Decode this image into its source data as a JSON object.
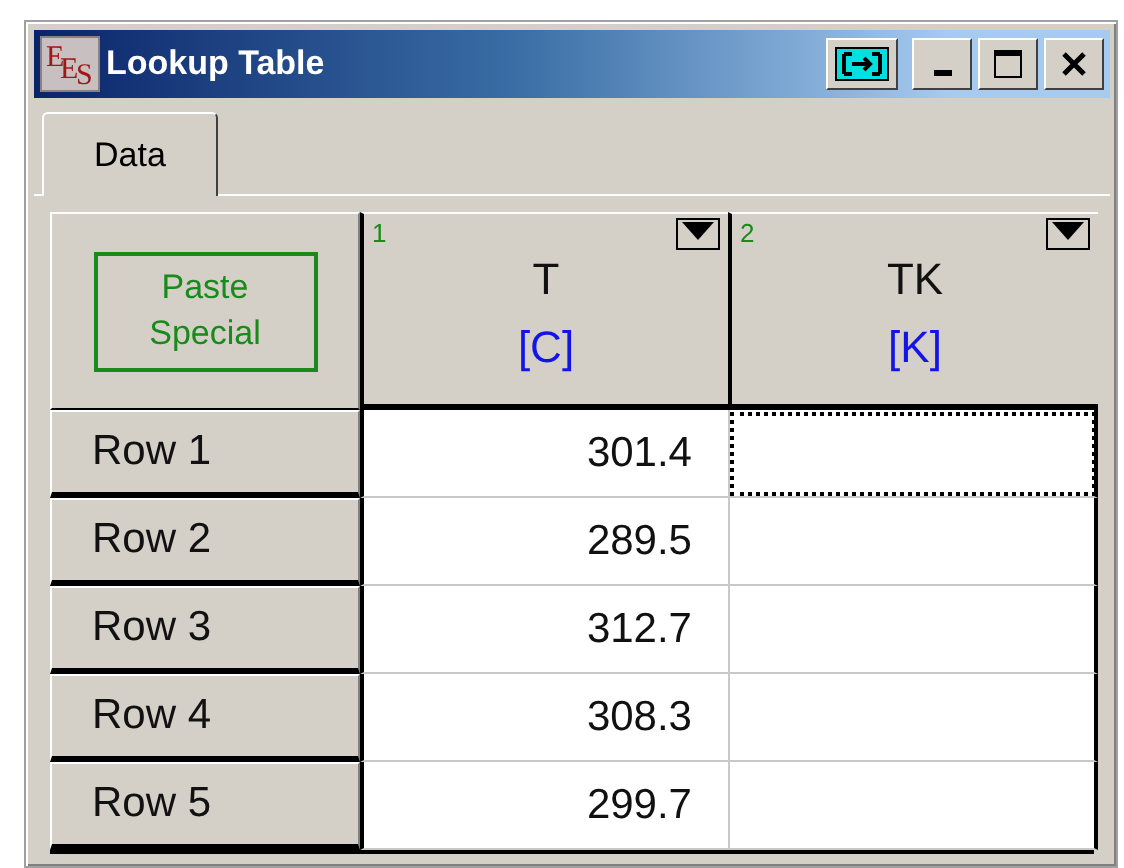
{
  "window": {
    "app_icon_text": "EES",
    "title": "Lookup Table"
  },
  "tabs": [
    {
      "label": "Data",
      "selected": true
    }
  ],
  "table": {
    "corner_button": "Paste Special",
    "columns": [
      {
        "number": "1",
        "name": "T",
        "unit": "[C]"
      },
      {
        "number": "2",
        "name": "TK",
        "unit": "[K]"
      }
    ],
    "rows": [
      {
        "label": "Row 1",
        "cells": [
          {
            "value": "301.4",
            "focused": false
          },
          {
            "focused": true
          }
        ]
      },
      {
        "label": "Row 2",
        "cells": [
          {
            "value": "289.5",
            "focused": false
          },
          {
            "focused": false
          }
        ]
      },
      {
        "label": "Row 3",
        "cells": [
          {
            "value": "312.7",
            "focused": false
          },
          {
            "focused": false
          }
        ]
      },
      {
        "label": "Row 4",
        "cells": [
          {
            "value": "308.3",
            "focused": false
          },
          {
            "focused": false
          }
        ]
      },
      {
        "label": "Row 5",
        "cells": [
          {
            "value": "299.7",
            "focused": false
          },
          {
            "focused": false
          }
        ]
      }
    ]
  }
}
